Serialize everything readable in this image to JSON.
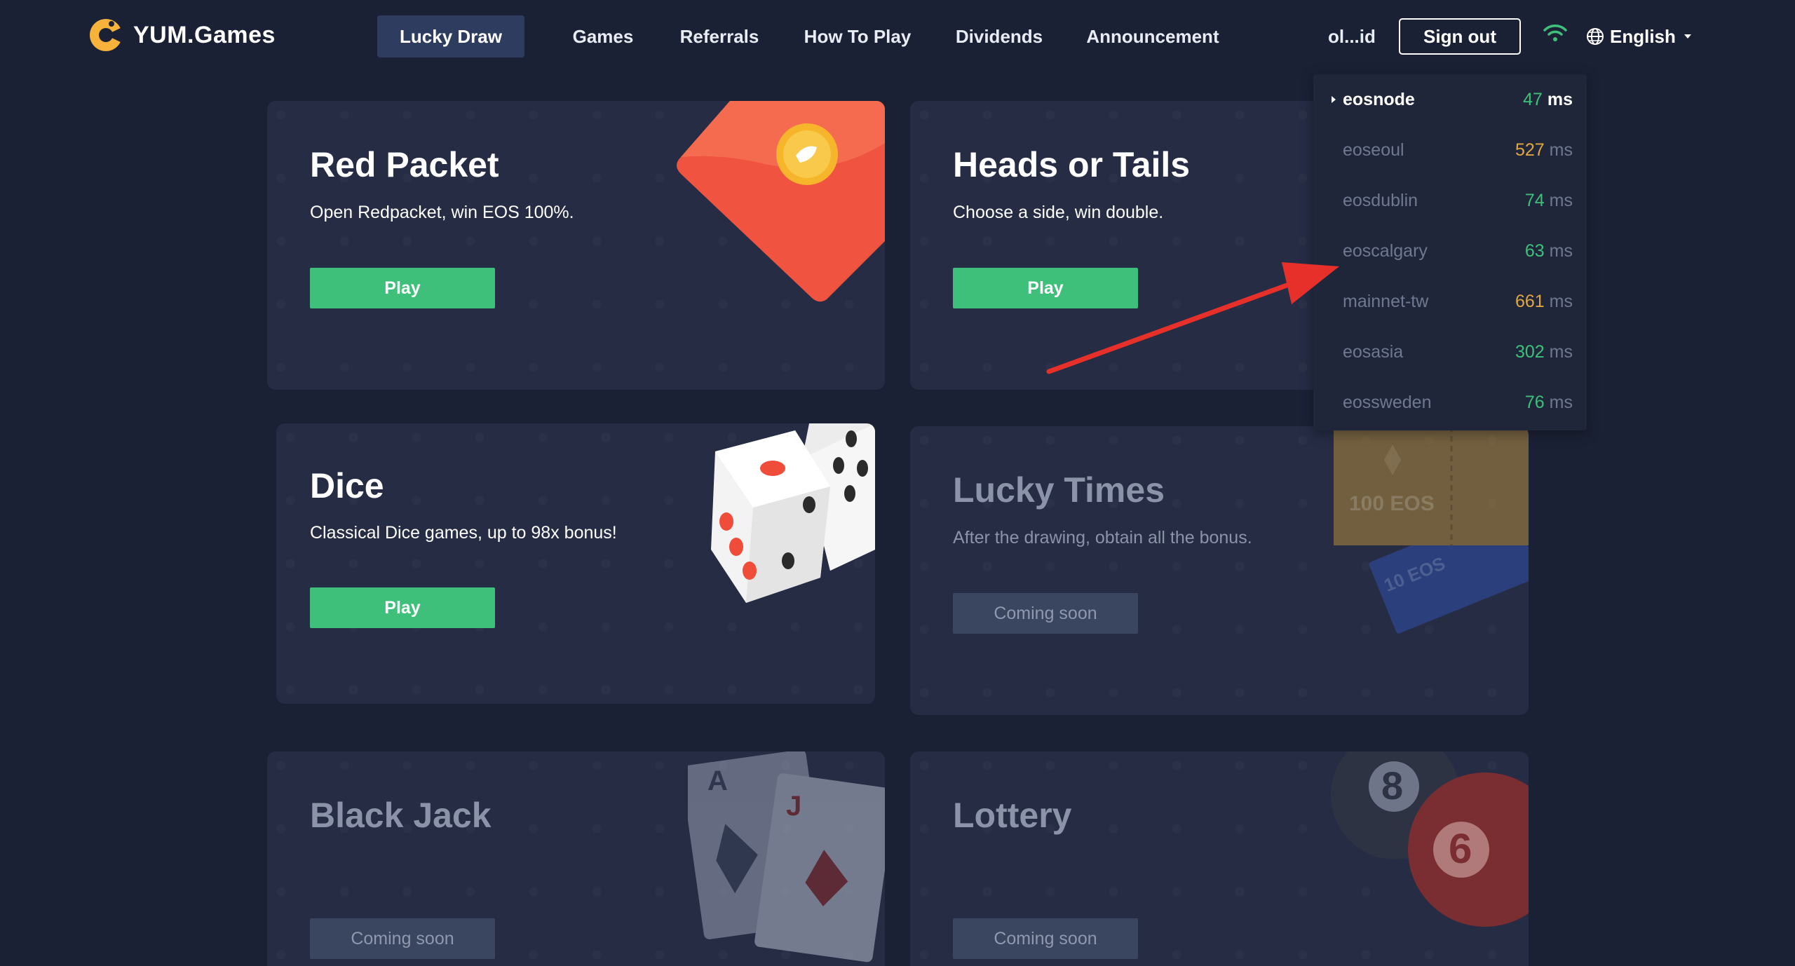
{
  "brand": {
    "name": "YUM.Games"
  },
  "nav": {
    "items": [
      "Lucky Draw",
      "Games",
      "Referrals",
      "How To Play",
      "Dividends",
      "Announcement"
    ],
    "active_index": 0,
    "user": "ol...id",
    "signout_label": "Sign out",
    "language": "English"
  },
  "games": [
    {
      "title": "Red Packet",
      "desc": "Open Redpacket, win EOS 100%.",
      "button": "Play",
      "status": "active"
    },
    {
      "title": "Heads or Tails",
      "desc": "Choose a side, win double.",
      "button": "Play",
      "status": "active"
    },
    {
      "title": "Dice",
      "desc": "Classical Dice games, up to 98x bonus!",
      "button": "Play",
      "status": "active"
    },
    {
      "title": "Lucky Times",
      "desc": "After the drawing, obtain all the bonus.",
      "button": "Coming soon",
      "status": "disabled",
      "art": {
        "ticket_big": "100 EOS",
        "ticket_small": "10 EOS"
      }
    },
    {
      "title": "Black Jack",
      "desc": "",
      "button": "Coming soon",
      "status": "disabled",
      "art": {
        "card1": "A",
        "card2": "J"
      }
    },
    {
      "title": "Lottery",
      "desc": "",
      "button": "Coming soon",
      "status": "disabled",
      "art": {
        "ball1": "8",
        "ball2": "6"
      }
    }
  ],
  "node_menu": {
    "unit": "ms",
    "nodes": [
      {
        "name": "eosnode",
        "latency": "47",
        "color": "#3ec07a",
        "selected": true
      },
      {
        "name": "eoseoul",
        "latency": "527",
        "color": "#e0a640",
        "selected": false
      },
      {
        "name": "eosdublin",
        "latency": "74",
        "color": "#3ec07a",
        "selected": false
      },
      {
        "name": "eoscalgary",
        "latency": "63",
        "color": "#3ec07a",
        "selected": false
      },
      {
        "name": "mainnet-tw",
        "latency": "661",
        "color": "#e0a640",
        "selected": false
      },
      {
        "name": "eosasia",
        "latency": "302",
        "color": "#3ec07a",
        "selected": false
      },
      {
        "name": "eossweden",
        "latency": "76",
        "color": "#3ec07a",
        "selected": false
      }
    ]
  },
  "colors": {
    "background": "#1b2135",
    "card": "#252c44",
    "play_green": "#3ec07a",
    "annotation_arrow": "#e8302a"
  }
}
